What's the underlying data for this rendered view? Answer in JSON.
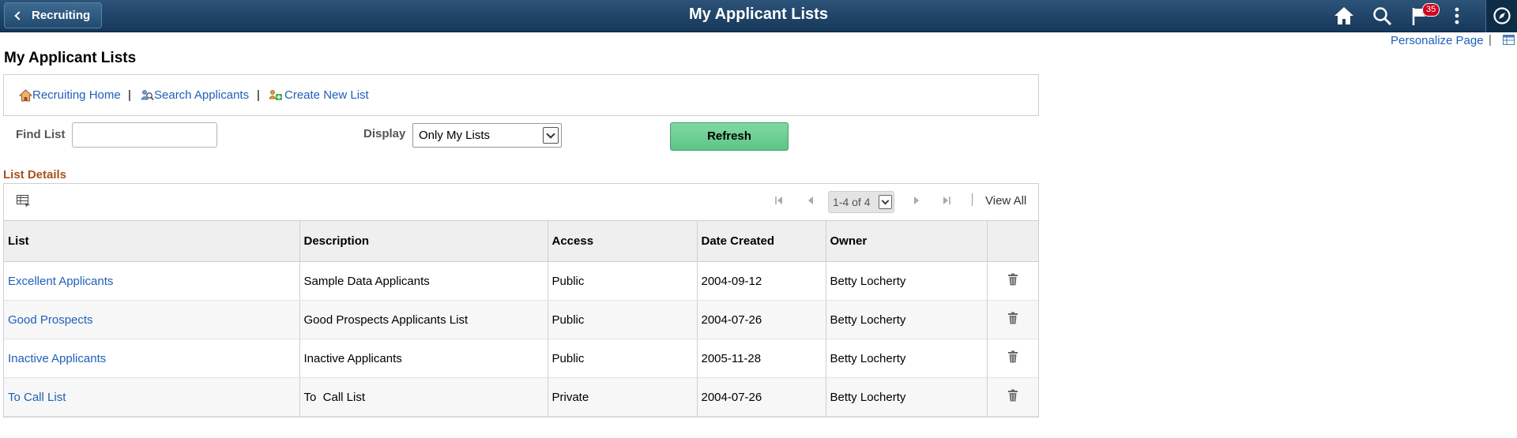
{
  "header": {
    "back_label": "Recruiting",
    "title": "My Applicant Lists",
    "notification_count": "35",
    "icons": [
      "home-icon",
      "search-icon",
      "flag-icon",
      "more-icon",
      "compass-icon"
    ],
    "bar_color": "#1f4568"
  },
  "personalize": {
    "label": "Personalize Page",
    "separator": "|"
  },
  "page": {
    "heading": "My Applicant Lists"
  },
  "links": {
    "home": "Recruiting Home",
    "search": "Search Applicants",
    "create": "Create New List",
    "separator": "|"
  },
  "filters": {
    "find_label": "Find List",
    "find_value": "",
    "display_label": "Display",
    "display_value": "Only My Lists",
    "refresh_label": "Refresh"
  },
  "list_details": {
    "title": "List Details",
    "pager": "1-4 of 4",
    "view_all": "View All",
    "columns": [
      "List",
      "Description",
      "Access",
      "Date Created",
      "Owner"
    ],
    "rows": [
      {
        "list": "Excellent Applicants",
        "description": "Sample Data Applicants",
        "access": "Public",
        "date": "2004-09-12",
        "owner": "Betty Locherty"
      },
      {
        "list": "Good Prospects",
        "description": "Good Prospects Applicants List",
        "access": "Public",
        "date": "2004-07-26",
        "owner": "Betty Locherty"
      },
      {
        "list": "Inactive Applicants",
        "description": "Inactive Applicants",
        "access": "Public",
        "date": "2005-11-28",
        "owner": "Betty Locherty"
      },
      {
        "list": "To Call List",
        "description": "To  Call List",
        "access": "Private",
        "date": "2004-07-26",
        "owner": "Betty Locherty"
      }
    ]
  },
  "colors": {
    "link": "#1f5fb9",
    "section_title": "#a8521c",
    "refresh_button": "#6ccf93"
  }
}
